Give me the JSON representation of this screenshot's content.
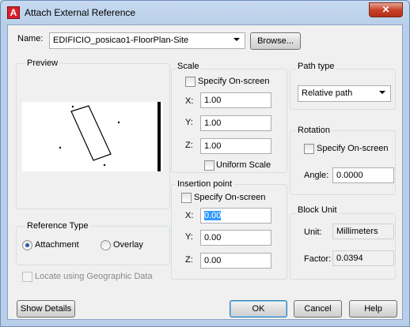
{
  "window": {
    "title": "Attach External Reference",
    "close_glyph": "✕",
    "app_icon_letter": "A"
  },
  "name_row": {
    "label": "Name:",
    "value": "EDIFICIO_posicao1-FloorPlan-Site",
    "browse_label": "Browse..."
  },
  "preview": {
    "title": "Preview"
  },
  "reference_type": {
    "title": "Reference Type",
    "options": [
      {
        "label": "Attachment",
        "selected": true
      },
      {
        "label": "Overlay",
        "selected": false
      }
    ]
  },
  "geo": {
    "label": "Locate using Geographic Data",
    "enabled": false
  },
  "scale": {
    "title": "Scale",
    "specify_label": "Specify On-screen",
    "x_label": "X:",
    "x_value": "1.00",
    "y_label": "Y:",
    "y_value": "1.00",
    "z_label": "Z:",
    "z_value": "1.00",
    "uniform_label": "Uniform Scale"
  },
  "insertion": {
    "title": "Insertion point",
    "specify_label": "Specify On-screen",
    "x_label": "X:",
    "x_value": "0.00",
    "y_label": "Y:",
    "y_value": "0.00",
    "z_label": "Z:",
    "z_value": "0.00"
  },
  "path_type": {
    "title": "Path type",
    "value": "Relative path"
  },
  "rotation": {
    "title": "Rotation",
    "specify_label": "Specify On-screen",
    "angle_label": "Angle:",
    "angle_value": "0.0000"
  },
  "block_unit": {
    "title": "Block Unit",
    "unit_label": "Unit:",
    "unit_value": "Millimeters",
    "factor_label": "Factor:",
    "factor_value": "0.0394"
  },
  "buttons": {
    "show_details": "Show Details",
    "ok": "OK",
    "cancel": "Cancel",
    "help": "Help"
  },
  "colors": {
    "frame": "#b9cfe9",
    "close": "#c7432a",
    "selection": "#3399ff",
    "radio_dot": "#1f56b0"
  }
}
